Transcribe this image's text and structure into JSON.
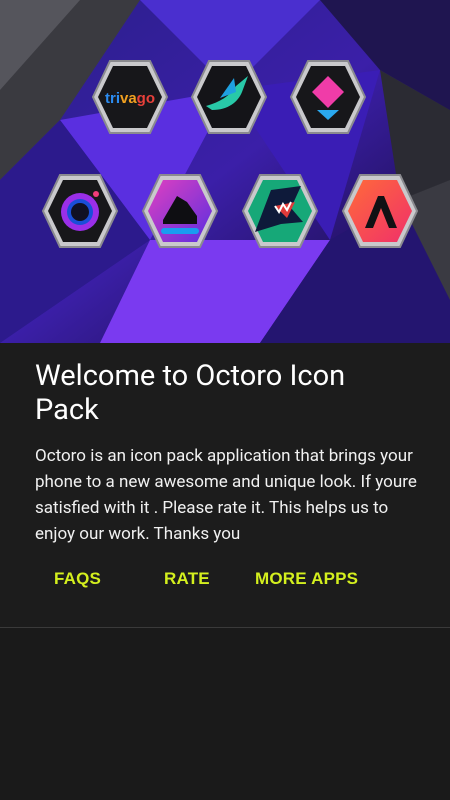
{
  "hero": {
    "icons": [
      {
        "name": "trivago-icon",
        "label": "trivago"
      },
      {
        "name": "bird-icon"
      },
      {
        "name": "diamond-arrow-icon"
      },
      {
        "name": "camera-lens-icon"
      },
      {
        "name": "shoe-icon"
      },
      {
        "name": "shark-icon"
      },
      {
        "name": "letter-a-icon"
      }
    ]
  },
  "welcome": {
    "title": "Welcome to Octoro Icon Pack",
    "description": "Octoro is an icon pack application that brings your phone to a new awesome and unique look. If youre satisfied with it . Please rate it. This helps us to enjoy our work. Thanks you"
  },
  "actions": {
    "faqs": "FAQS",
    "rate": "RATE",
    "more_apps": "MORE APPS"
  },
  "colors": {
    "accent": "#d4ef1e",
    "card_bg": "#1c1c1c",
    "hero_bg": "#160b3a"
  }
}
